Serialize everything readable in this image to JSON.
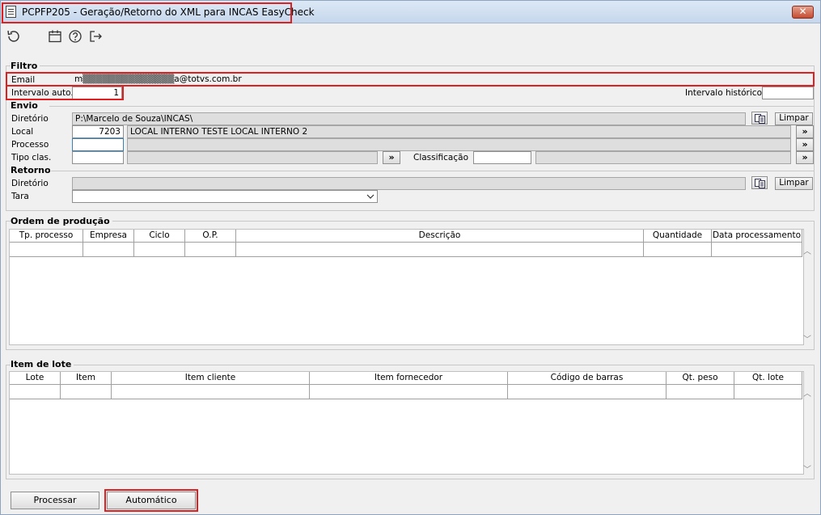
{
  "window": {
    "title": "PCPFP205 - Geração/Retorno do XML para INCAS EasyCheck",
    "close_label": "✕"
  },
  "toolbar": {
    "icons": [
      "undo-icon",
      "calendar-icon",
      "help-icon",
      "exit-icon"
    ]
  },
  "filtro": {
    "title": "Filtro",
    "email_label": "Email",
    "email_value": "m▒▒▒▒▒▒▒▒▒▒▒▒▒▒a@totvs.com.br",
    "intervalo_auto_label": "Intervalo auto.",
    "intervalo_auto_value": "1",
    "intervalo_historico_label": "Intervalo histórico",
    "intervalo_historico_value": ""
  },
  "envio": {
    "title": "Envio",
    "diretorio_label": "Diretório",
    "diretorio_value": "P:\\Marcelo de Souza\\INCAS\\",
    "limpar_label": "Limpar",
    "local_label": "Local",
    "local_code": "7203",
    "local_desc": "LOCAL INTERNO TESTE LOCAL INTERNO 2",
    "processo_label": "Processo",
    "tipo_clas_label": "Tipo clas.",
    "classificacao_label": "Classificação",
    "chevron_label": "»"
  },
  "retorno": {
    "title": "Retorno",
    "diretorio_label": "Diretório",
    "limpar_label": "Limpar",
    "tara_label": "Tara"
  },
  "ordem_producao": {
    "title": "Ordem de produção",
    "columns": [
      "Tp. processo",
      "Empresa",
      "Ciclo",
      "O.P.",
      "Descrição",
      "Quantidade",
      "Data processamento"
    ]
  },
  "item_lote": {
    "title": "Item de lote",
    "columns": [
      "Lote",
      "Item",
      "Item cliente",
      "Item fornecedor",
      "Código de barras",
      "Qt. peso",
      "Qt. lote"
    ]
  },
  "footer": {
    "processar_label": "Processar",
    "automatico_label": "Automático"
  }
}
